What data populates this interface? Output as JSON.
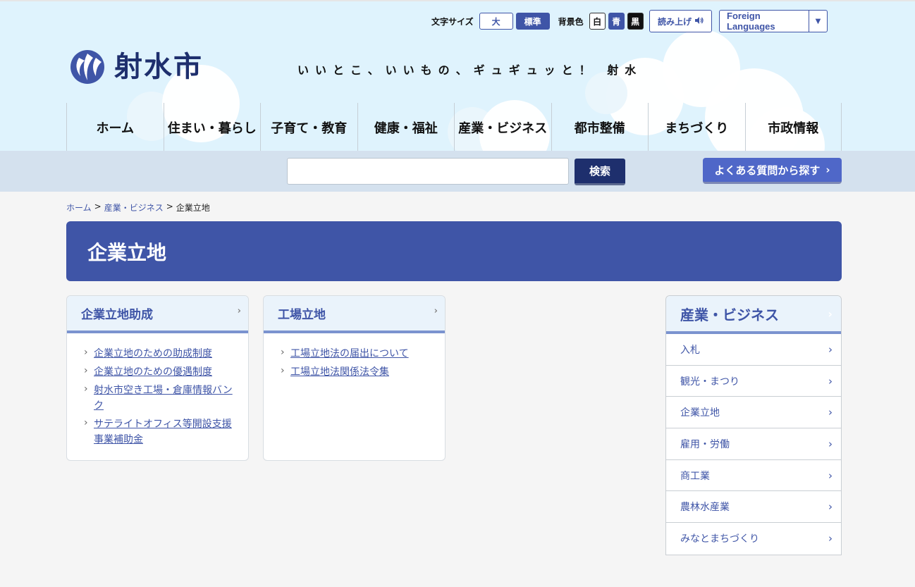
{
  "utility": {
    "font_size_label": "文字サイズ",
    "font_large": "大",
    "font_standard": "標準",
    "bg_label": "背景色",
    "bg_white": "白",
    "bg_blue": "青",
    "bg_black": "黒",
    "read_aloud": "読み上げ",
    "foreign_languages": "Foreign Languages"
  },
  "logo": {
    "text": "射水市"
  },
  "catchphrase": "いいとこ、いいもの、ギュギュッと！ 射水",
  "global_nav": [
    {
      "label": "ホーム"
    },
    {
      "label": "住まい・暮らし"
    },
    {
      "label": "子育て・教育"
    },
    {
      "label": "健康・福祉"
    },
    {
      "label": "産業・ビジネス"
    },
    {
      "label": "都市整備"
    },
    {
      "label": "まちづくり"
    },
    {
      "label": "市政情報"
    }
  ],
  "search": {
    "placeholder": "",
    "button": "検索",
    "faq_button": "よくある質問から探す"
  },
  "breadcrumb": {
    "home": "ホーム",
    "sep1": ">",
    "parent": "産業・ビジネス",
    "sep2": ">",
    "current": "企業立地"
  },
  "page_title": "企業立地",
  "cards": [
    {
      "title": "企業立地助成",
      "links": [
        "企業立地のための助成制度",
        "企業立地のための優遇制度",
        "射水市空き工場・倉庫情報バンク",
        "サテライトオフィス等開設支援事業補助金"
      ]
    },
    {
      "title": "工場立地",
      "links": [
        "工場立地法の届出について",
        "工場立地法関係法令集"
      ]
    }
  ],
  "side_nav": {
    "title": "産業・ビジネス",
    "items": [
      {
        "label": "入札"
      },
      {
        "label": "観光・まつり"
      },
      {
        "label": "企業立地"
      },
      {
        "label": "雇用・労働"
      },
      {
        "label": "商工業"
      },
      {
        "label": "農林水産業"
      },
      {
        "label": "みなとまちづくり"
      }
    ]
  },
  "colors": {
    "primary": "#3f55a7",
    "header_bg": "#dff3fd",
    "navy": "#1e2f6d"
  }
}
